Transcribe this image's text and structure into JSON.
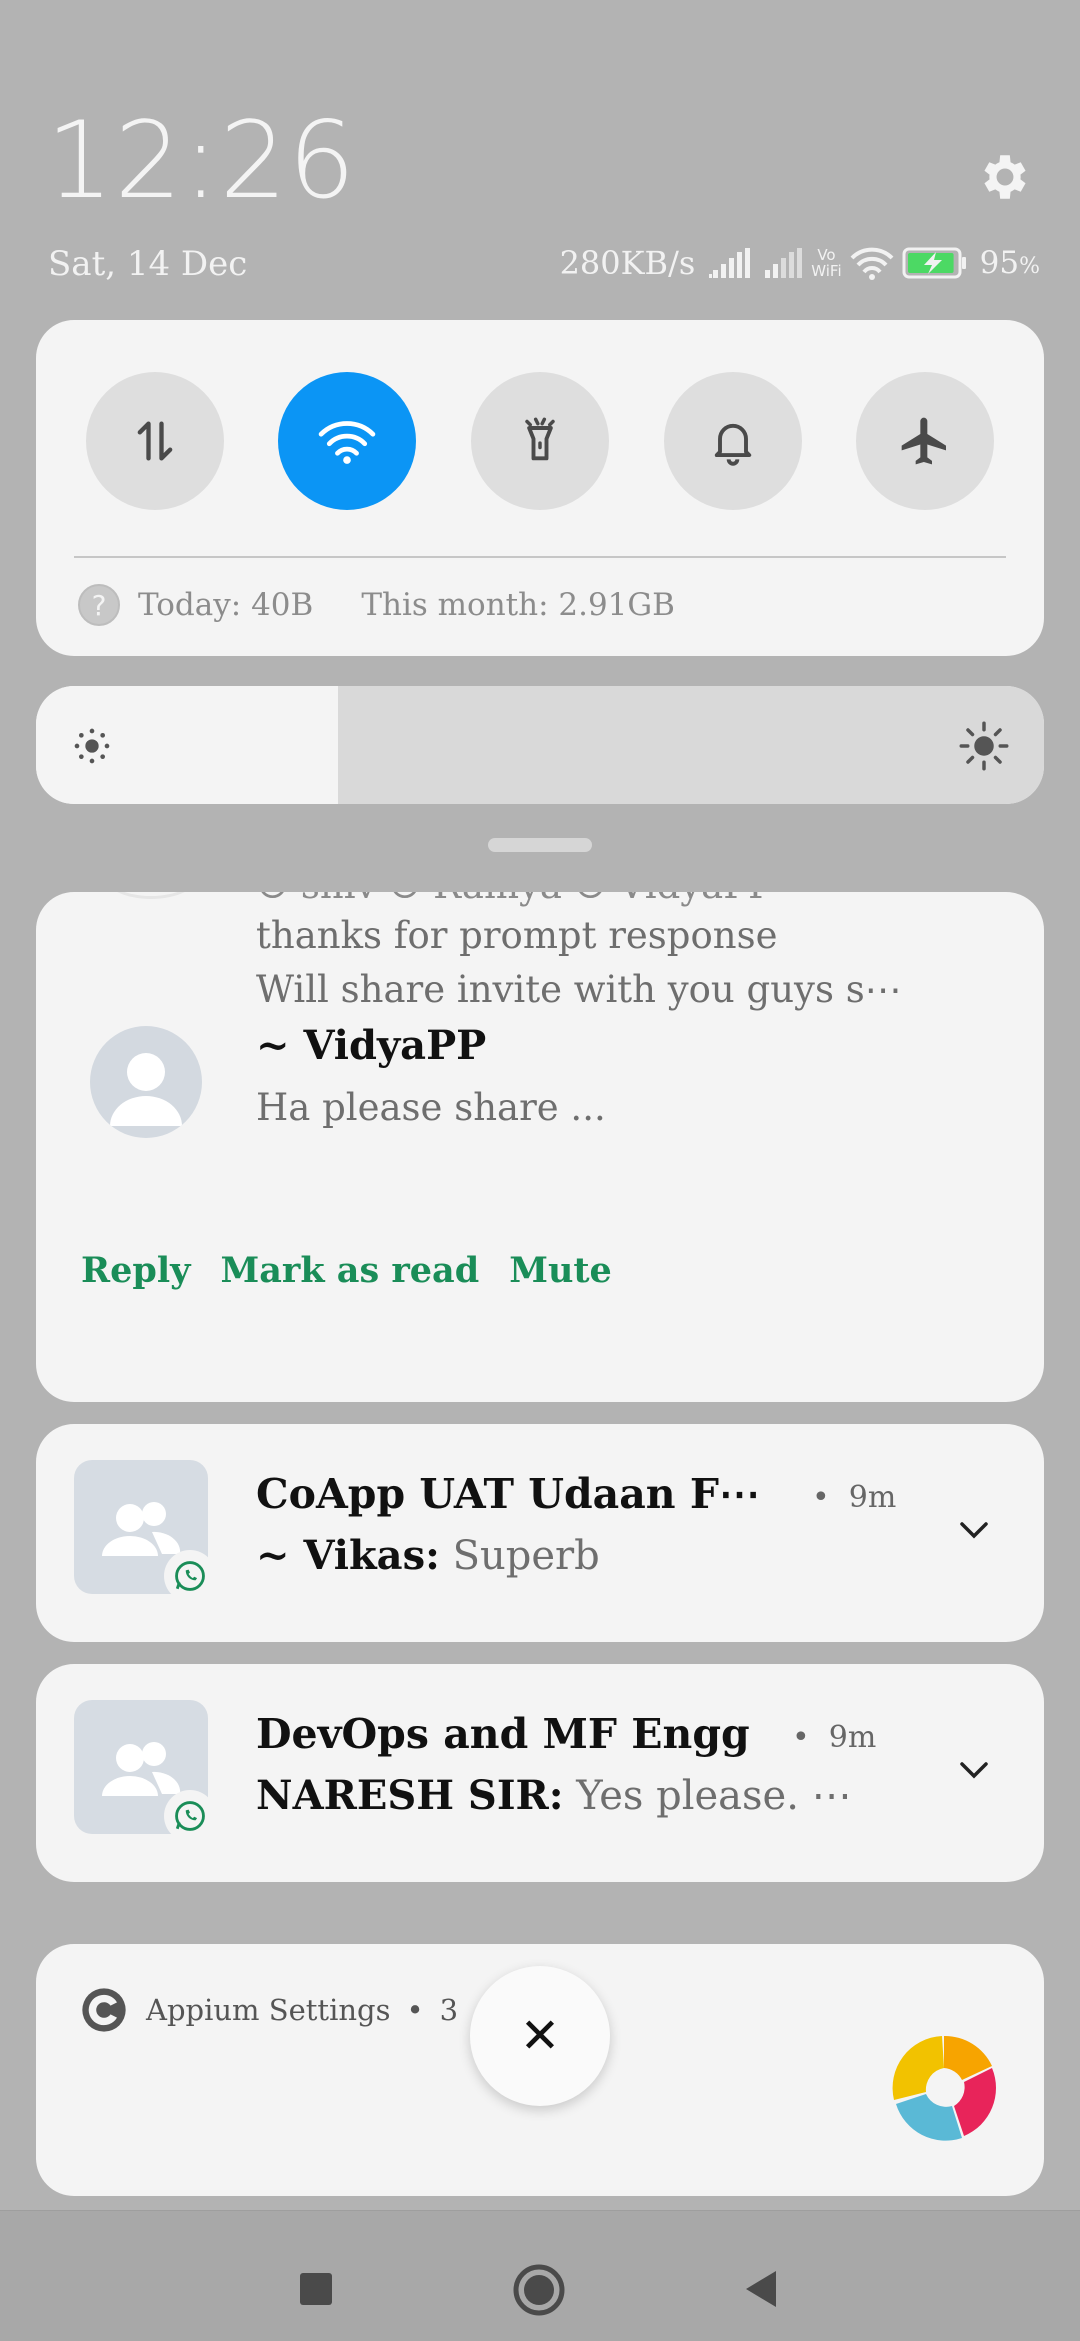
{
  "status_bar": {
    "time": "12:26",
    "date": "Sat, 14 Dec",
    "net_speed": "280KB/s",
    "volte_line1": "Vo",
    "volte_line2": "WiFi",
    "battery_number": "95",
    "battery_unit": "%",
    "battery_level": 0.95,
    "icons": [
      "gear-icon",
      "signal-icon",
      "signal-icon",
      "volte-wifi-icon",
      "wifi-icon",
      "battery-charging-icon"
    ]
  },
  "quick_settings": {
    "tiles": [
      {
        "name": "mobile-data",
        "icon": "data-arrows-icon",
        "active": false
      },
      {
        "name": "wifi",
        "icon": "wifi-icon",
        "active": true
      },
      {
        "name": "flashlight",
        "icon": "flashlight-icon",
        "active": false
      },
      {
        "name": "sound",
        "icon": "bell-icon",
        "active": false
      },
      {
        "name": "airplane-mode",
        "icon": "airplane-icon",
        "active": false
      }
    ],
    "help_glyph": "?",
    "today_usage": "Today: 40B",
    "month_usage": "This month: 2.91GB",
    "active_color": "#0b95f5"
  },
  "brightness": {
    "level": 0.3
  },
  "message_notification": {
    "cut_line": "☺ shiv ☺ Ramya ☺ VidyaPP",
    "line1": "thanks for prompt response",
    "line2": "Will share invite with you guys s⋯",
    "sender": "~ VidyaPP",
    "message": "Ha please share ...",
    "actions": {
      "reply": "Reply",
      "mark_read": "Mark as read",
      "mute": "Mute"
    },
    "action_color": "#1a8d58"
  },
  "chat_notifications": [
    {
      "title": "CoApp UAT Udaan F⋯",
      "separator": "•",
      "time": "9m",
      "sender": "~ Vikas:",
      "text": "Superb"
    },
    {
      "title": "DevOps and MF Engg",
      "separator": "•",
      "time": "9m",
      "sender": "NARESH SIR:",
      "text": "Yes please. ⋯"
    }
  ],
  "appium": {
    "app_name": "Appium Settings",
    "separator": "•",
    "time_partial": "3"
  },
  "close_glyph": "✕"
}
